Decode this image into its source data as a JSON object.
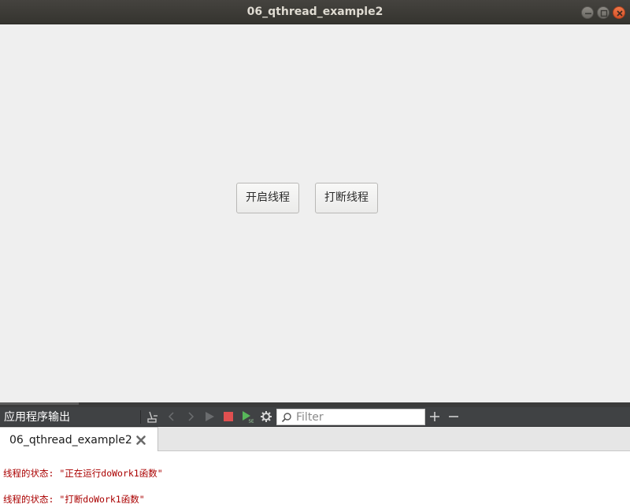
{
  "window": {
    "title": "06_qthread_example2",
    "controls": [
      "minimize-icon",
      "maximize-icon",
      "close-icon"
    ]
  },
  "main": {
    "buttons": [
      {
        "label": "开启线程"
      },
      {
        "label": "打断线程"
      }
    ]
  },
  "output_pane": {
    "title": "应用程序输出",
    "toolbar_icons": [
      "clear-icon",
      "previous-icon",
      "next-icon",
      "run-icon",
      "stop-icon",
      "debug-run-icon",
      "settings-icon"
    ],
    "filter": {
      "placeholder": "Filter",
      "value": ""
    },
    "zoom_icons": [
      "zoom-in-icon",
      "zoom-out-icon"
    ],
    "tabs": [
      {
        "label": "06_qthread_example2"
      }
    ],
    "lines": [
      "线程的状态: \"正在运行doWork1函数\"",
      "线程的状态: \"打断doWork1函数\""
    ]
  },
  "colors": {
    "titlebar": "#3c3b37",
    "toolbar": "#404244",
    "output_text": "#aa0000",
    "stop": "#e05050",
    "run_disabled": "#6a6c6e",
    "debug_run": "#58b85a"
  }
}
